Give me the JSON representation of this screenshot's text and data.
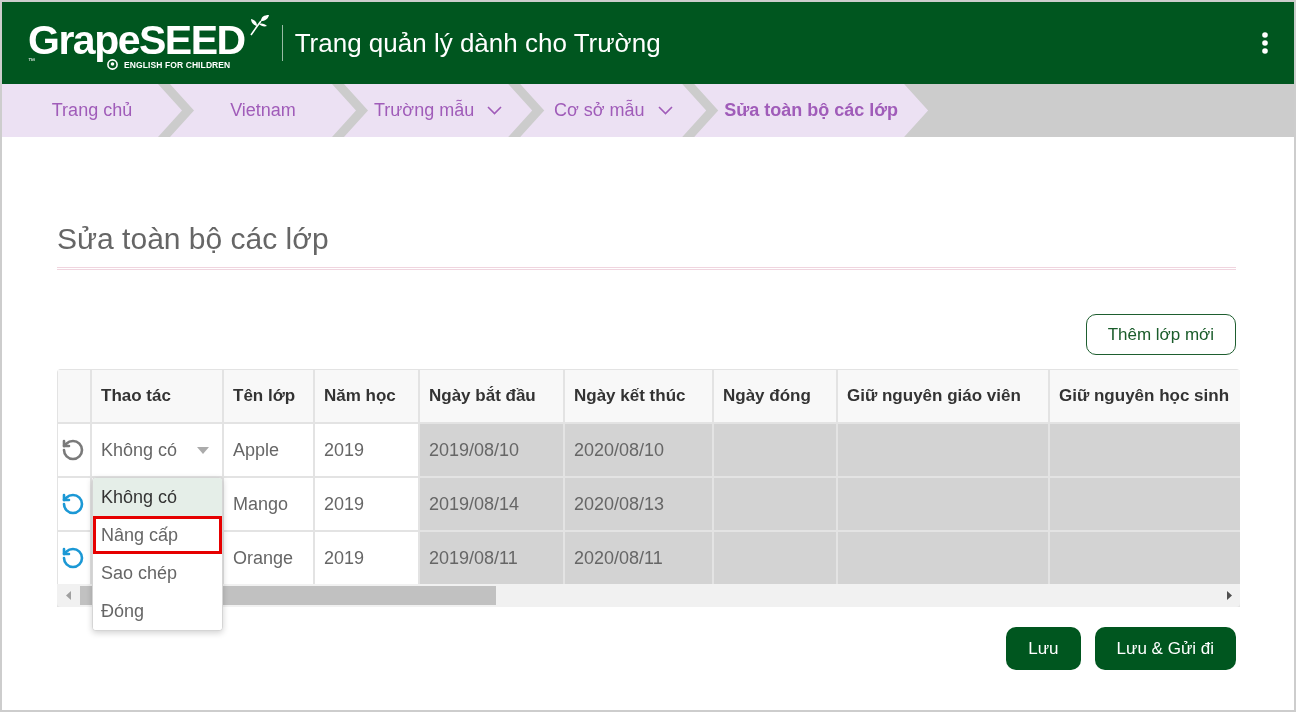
{
  "header": {
    "logo": {
      "wordmark": "GrapeSEED",
      "trademark": "™",
      "tagline": "ENGLISH FOR CHILDREN"
    },
    "title": "Trang quản lý dành cho Trường"
  },
  "breadcrumb": [
    {
      "label": "Trang chủ",
      "has_menu": false,
      "selected": false
    },
    {
      "label": "Vietnam",
      "has_menu": false,
      "selected": false
    },
    {
      "label": "Trường mẫu",
      "has_menu": true,
      "selected": false
    },
    {
      "label": "Cơ sở mẫu",
      "has_menu": true,
      "selected": false
    },
    {
      "label": "Sửa toàn bộ các lớp",
      "has_menu": false,
      "selected": true
    }
  ],
  "page_title": "Sửa toàn bộ các lớp",
  "add_button": "Thêm lớp mới",
  "table": {
    "columns": [
      {
        "label": "Thao tác",
        "locked": false
      },
      {
        "label": "Tên lớp",
        "locked": false
      },
      {
        "label": "Năm học",
        "locked": false
      },
      {
        "label": "Ngày bắt đầu",
        "locked": true
      },
      {
        "label": "Ngày kết thúc",
        "locked": true
      },
      {
        "label": "Ngày đóng",
        "locked": true
      },
      {
        "label": "Giữ nguyên giáo viên",
        "locked": true
      },
      {
        "label": "Giữ nguyên học sinh",
        "locked": true
      }
    ],
    "rows": [
      {
        "revert_enabled": false,
        "cells": [
          "Không có",
          "Apple",
          "2019",
          "2019/08/10",
          "2020/08/10"
        ],
        "action_menu": {
          "open": true,
          "options": [
            {
              "label": "Không có",
              "selected": true,
              "annotated": false
            },
            {
              "label": "Nâng cấp",
              "selected": false,
              "annotated": true
            },
            {
              "label": "Sao chép",
              "selected": false,
              "annotated": false
            },
            {
              "label": "Đóng",
              "selected": false,
              "annotated": false
            }
          ]
        }
      },
      {
        "revert_enabled": true,
        "cells": [
          "",
          "Mango",
          "2019",
          "2019/08/14",
          "2020/08/13"
        ]
      },
      {
        "revert_enabled": true,
        "cells": [
          "",
          "Orange",
          "2019",
          "2019/08/11",
          "2020/08/11"
        ]
      }
    ]
  },
  "buttons": [
    "Lưu",
    "Lưu & Gửi đi"
  ]
}
